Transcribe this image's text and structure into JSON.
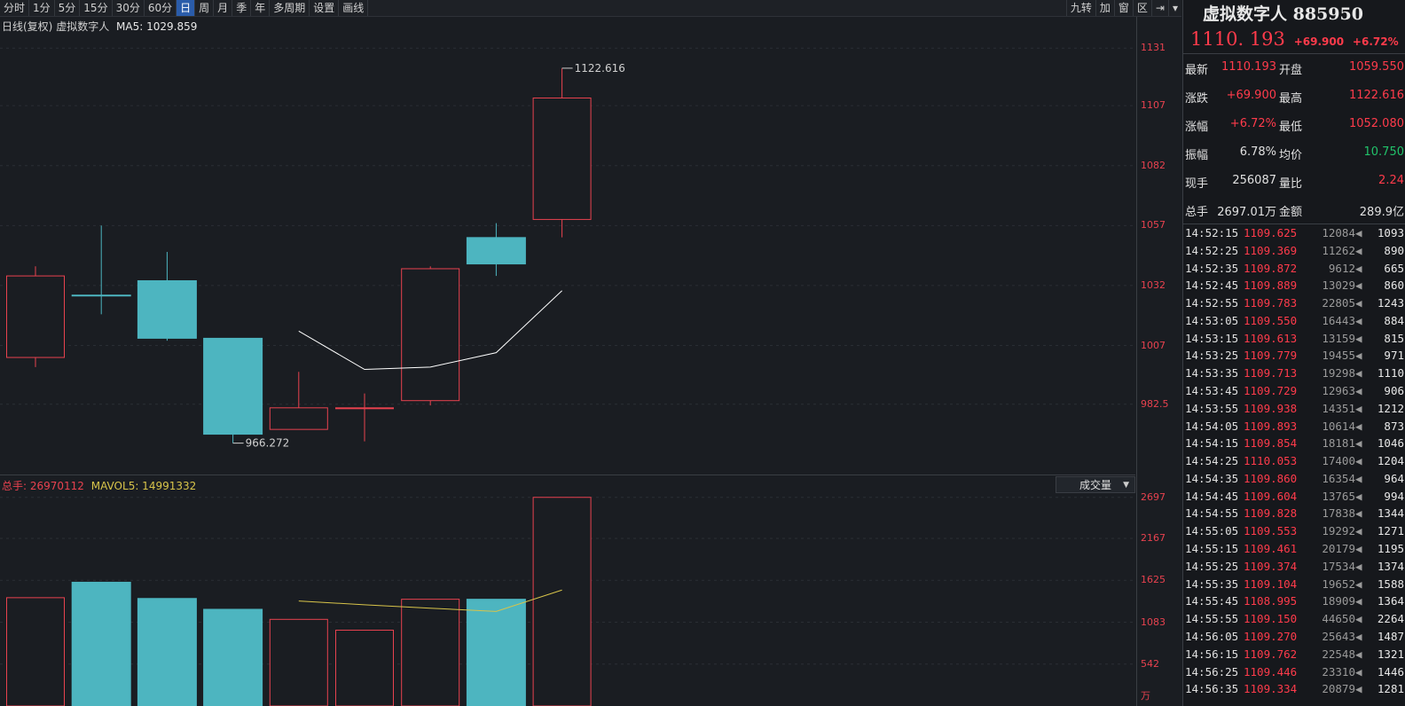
{
  "toolbar": {
    "periods": [
      "分时",
      "1分",
      "5分",
      "15分",
      "30分",
      "60分",
      "日",
      "周",
      "月",
      "季",
      "年",
      "多周期",
      "设置",
      "画线"
    ],
    "active": "日",
    "right_tools": [
      "九转",
      "加",
      "窗",
      "区"
    ]
  },
  "chart": {
    "title": "日线(复权)",
    "name": "虚拟数字人",
    "ma5": "MA5: 1029.859",
    "high_label": "1122.616",
    "low_label": "966.272"
  },
  "price_axis": [
    "1131",
    "1107",
    "1082",
    "1057",
    "1032",
    "1007",
    "982.5"
  ],
  "volume": {
    "total_label": "总手: 26970112",
    "mavol_label": "MAVOL5: 14991332",
    "select_label": "成交量",
    "axis": [
      "2697",
      "2167",
      "1625",
      "1083",
      "542"
    ],
    "unit": "万"
  },
  "chart_data": {
    "type": "candlestick",
    "candles": [
      {
        "open": 1002,
        "close": 1036,
        "high": 1040,
        "low": 998,
        "up": true
      },
      {
        "open": 1028,
        "close": 1028,
        "high": 1057,
        "low": 1020,
        "up": false
      },
      {
        "open": 1034,
        "close": 1010,
        "high": 1046,
        "low": 1009,
        "up": false
      },
      {
        "open": 1010,
        "close": 970,
        "high": 1010,
        "low": 966.272,
        "up": false
      },
      {
        "open": 972,
        "close": 981,
        "high": 996,
        "low": 972,
        "up": true
      },
      {
        "open": 981,
        "close": 981,
        "high": 987,
        "low": 967,
        "up": true
      },
      {
        "open": 984,
        "close": 1039,
        "high": 1040,
        "low": 982,
        "up": true
      },
      {
        "open": 1041,
        "close": 1052,
        "high": 1058,
        "low": 1036,
        "up": false
      },
      {
        "open": 1059.55,
        "close": 1110.193,
        "high": 1122.616,
        "low": 1052.08,
        "up": true
      }
    ],
    "ma5": [
      null,
      null,
      null,
      null,
      1013,
      997,
      998,
      1004,
      1029.859
    ],
    "volume": [
      1400,
      1600,
      1390,
      1250,
      1120,
      980,
      1380,
      1380,
      2697
    ],
    "mavol5": [
      null,
      null,
      null,
      null,
      1357,
      1308,
      1264,
      1222,
      1499
    ],
    "price_range": [
      958,
      1137
    ],
    "volume_range": [
      0,
      2740
    ],
    "colors": {
      "up": "#e8424f",
      "down": "#4db5c0",
      "ma": "#ffffff",
      "mavol": "#d8c44a"
    }
  },
  "panel": {
    "name": "虚拟数字人 885950",
    "price": "1110. 193",
    "change": "+69.900",
    "change_pct": "+6.72%",
    "quotes": [
      {
        "l1": "最新",
        "v1": "1110.193",
        "c1": "red",
        "l2": "开盘",
        "v2": "1059.550",
        "c2": "red"
      },
      {
        "l1": "涨跌",
        "v1": "+69.900",
        "c1": "red",
        "l2": "最高",
        "v2": "1122.616",
        "c2": "red"
      },
      {
        "l1": "涨幅",
        "v1": "+6.72%",
        "c1": "red",
        "l2": "最低",
        "v2": "1052.080",
        "c2": "red"
      },
      {
        "l1": "振幅",
        "v1": "6.78%",
        "c1": "white",
        "l2": "均价",
        "v2": "10.750",
        "c2": "green"
      },
      {
        "l1": "现手",
        "v1": "256087",
        "c1": "white",
        "l2": "量比",
        "v2": "2.24",
        "c2": "red"
      },
      {
        "l1": "总手",
        "v1": "2697.01万",
        "c1": "white",
        "l2": "金额",
        "v2": "289.9亿",
        "c2": "white"
      }
    ],
    "ticks": [
      {
        "t": "14:52:15",
        "p": "1109.625",
        "v": "12084",
        "n": "1093"
      },
      {
        "t": "14:52:25",
        "p": "1109.369",
        "v": "11262",
        "n": "890"
      },
      {
        "t": "14:52:35",
        "p": "1109.872",
        "v": "9612",
        "n": "665"
      },
      {
        "t": "14:52:45",
        "p": "1109.889",
        "v": "13029",
        "n": "860"
      },
      {
        "t": "14:52:55",
        "p": "1109.783",
        "v": "22805",
        "n": "1243"
      },
      {
        "t": "14:53:05",
        "p": "1109.550",
        "v": "16443",
        "n": "884"
      },
      {
        "t": "14:53:15",
        "p": "1109.613",
        "v": "13159",
        "n": "815"
      },
      {
        "t": "14:53:25",
        "p": "1109.779",
        "v": "19455",
        "n": "971"
      },
      {
        "t": "14:53:35",
        "p": "1109.713",
        "v": "19298",
        "n": "1110"
      },
      {
        "t": "14:53:45",
        "p": "1109.729",
        "v": "12963",
        "n": "906"
      },
      {
        "t": "14:53:55",
        "p": "1109.938",
        "v": "14351",
        "n": "1212"
      },
      {
        "t": "14:54:05",
        "p": "1109.893",
        "v": "10614",
        "n": "873"
      },
      {
        "t": "14:54:15",
        "p": "1109.854",
        "v": "18181",
        "n": "1046"
      },
      {
        "t": "14:54:25",
        "p": "1110.053",
        "v": "17400",
        "n": "1204"
      },
      {
        "t": "14:54:35",
        "p": "1109.860",
        "v": "16354",
        "n": "964"
      },
      {
        "t": "14:54:45",
        "p": "1109.604",
        "v": "13765",
        "n": "994"
      },
      {
        "t": "14:54:55",
        "p": "1109.828",
        "v": "17838",
        "n": "1344"
      },
      {
        "t": "14:55:05",
        "p": "1109.553",
        "v": "19292",
        "n": "1271"
      },
      {
        "t": "14:55:15",
        "p": "1109.461",
        "v": "20179",
        "n": "1195"
      },
      {
        "t": "14:55:25",
        "p": "1109.374",
        "v": "17534",
        "n": "1374"
      },
      {
        "t": "14:55:35",
        "p": "1109.104",
        "v": "19652",
        "n": "1588"
      },
      {
        "t": "14:55:45",
        "p": "1108.995",
        "v": "18909",
        "n": "1364"
      },
      {
        "t": "14:55:55",
        "p": "1109.150",
        "v": "44650",
        "n": "2264"
      },
      {
        "t": "14:56:05",
        "p": "1109.270",
        "v": "25643",
        "n": "1487"
      },
      {
        "t": "14:56:15",
        "p": "1109.762",
        "v": "22548",
        "n": "1321"
      },
      {
        "t": "14:56:25",
        "p": "1109.446",
        "v": "23310",
        "n": "1446"
      },
      {
        "t": "14:56:35",
        "p": "1109.334",
        "v": "20879",
        "n": "1281"
      }
    ]
  }
}
